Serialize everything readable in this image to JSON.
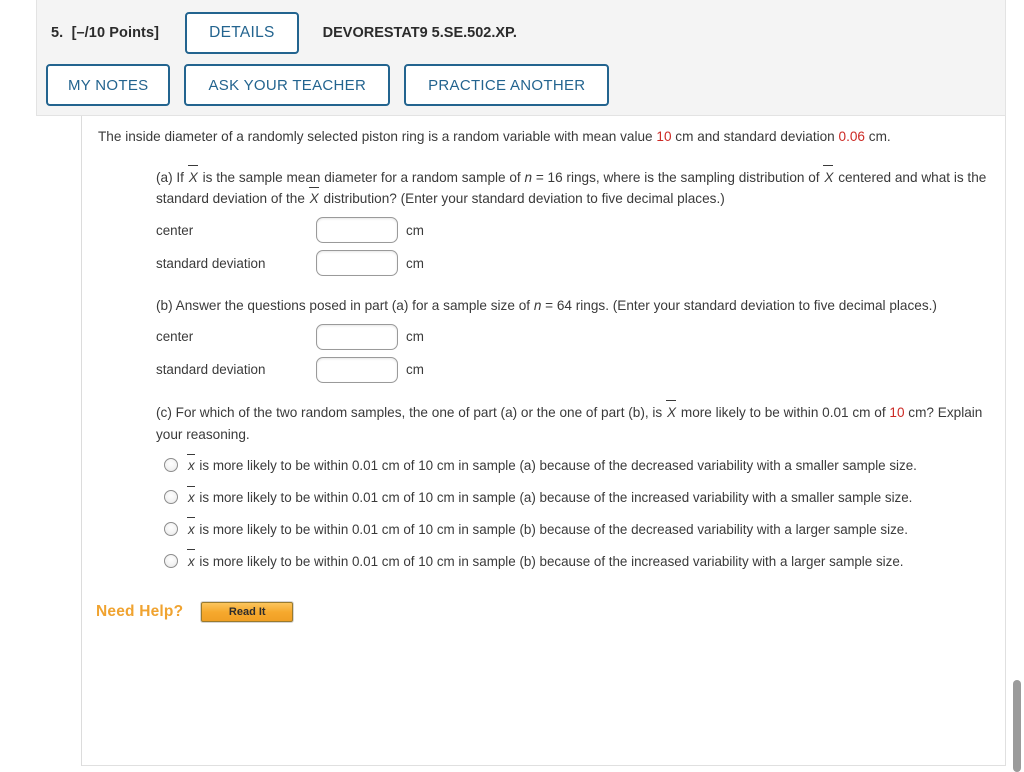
{
  "header": {
    "question_number": "5.",
    "points": "[–/10 Points]",
    "details_label": "DETAILS",
    "question_code": "DEVORESTAT9 5.SE.502.XP.",
    "my_notes_label": "MY NOTES",
    "ask_teacher_label": "ASK YOUR TEACHER",
    "practice_another_label": "PRACTICE ANOTHER"
  },
  "colors": {
    "accent_blue": "#23648f",
    "highlight_red": "#cc2a25",
    "need_help_orange": "#f0a330",
    "panel_gray": "#f4f4f4"
  },
  "stem": {
    "text_before_mean": "The inside diameter of a randomly selected piston ring is a random variable with mean value ",
    "mean_value": "10",
    "text_mid": " cm and standard deviation ",
    "sd_value": "0.06",
    "text_after": " cm."
  },
  "parts": [
    {
      "id": "a",
      "label": "(a)",
      "text_1": "If ",
      "xbar": "X",
      "text_2": " is the sample mean diameter for a random sample of ",
      "n_sym": "n",
      "text_3": " = 16 rings, where is the sampling distribution of ",
      "text_4": " centered and what is the standard deviation of the ",
      "text_5": " distribution? (Enter your standard deviation to five decimal places.)",
      "fields": [
        {
          "label": "center",
          "value": "",
          "placeholder": "",
          "unit": "cm"
        },
        {
          "label": "standard deviation",
          "value": "",
          "placeholder": "",
          "unit": "cm"
        }
      ]
    },
    {
      "id": "b",
      "label": "(b)",
      "text_1": "Answer the questions posed in part (a) for a sample size of ",
      "n_sym": "n",
      "text_2": " = 64 rings. (Enter your standard deviation to five decimal places.)",
      "fields": [
        {
          "label": "center",
          "value": "",
          "placeholder": "",
          "unit": "cm"
        },
        {
          "label": "standard deviation",
          "value": "",
          "placeholder": "",
          "unit": "cm"
        }
      ]
    },
    {
      "id": "c",
      "label": "(c)",
      "text_1": "For which of the two random samples, the one of part (a) or the one of part (b), is ",
      "xbar": "X",
      "text_2": " more likely to be within 0.01 cm of ",
      "highlight": "10",
      "text_3": " cm? Explain your reasoning."
    }
  ],
  "options": [
    {
      "xbar": "x",
      "text": " is more likely to be within 0.01 cm of 10 cm in sample (a) because of the decreased variability with a smaller sample size.",
      "selected": false
    },
    {
      "xbar": "x",
      "text": " is more likely to be within 0.01 cm of 10 cm in sample (a) because of the increased variability with a smaller sample size.",
      "selected": false
    },
    {
      "xbar": "x",
      "text": " is more likely to be within 0.01 cm of 10 cm in sample (b) because of the decreased variability with a larger sample size.",
      "selected": false
    },
    {
      "xbar": "x",
      "text": " is more likely to be within 0.01 cm of 10 cm in sample (b) because of the increased variability with a larger sample size.",
      "selected": false
    }
  ],
  "need_help": {
    "label": "Need Help?",
    "read_it_label": "Read It"
  }
}
